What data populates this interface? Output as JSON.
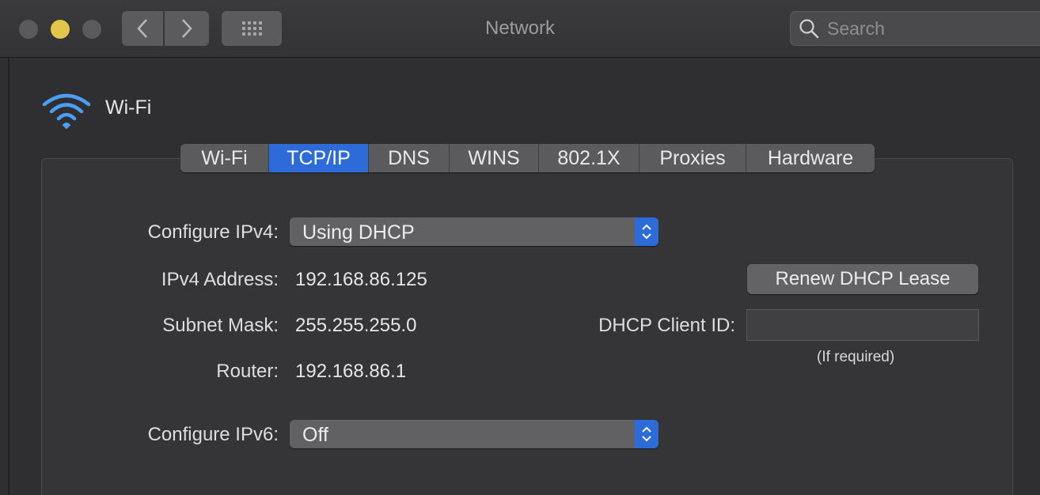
{
  "window": {
    "title": "Network"
  },
  "search": {
    "placeholder": "Search"
  },
  "interface": {
    "name": "Wi-Fi"
  },
  "tabs": [
    {
      "label": "Wi-Fi",
      "active": false
    },
    {
      "label": "TCP/IP",
      "active": true
    },
    {
      "label": "DNS",
      "active": false
    },
    {
      "label": "WINS",
      "active": false
    },
    {
      "label": "802.1X",
      "active": false
    },
    {
      "label": "Proxies",
      "active": false
    },
    {
      "label": "Hardware",
      "active": false
    }
  ],
  "tcpip": {
    "configure_ipv4_label": "Configure IPv4:",
    "configure_ipv4_value": "Using DHCP",
    "ipv4_address_label": "IPv4 Address:",
    "ipv4_address_value": "192.168.86.125",
    "subnet_mask_label": "Subnet Mask:",
    "subnet_mask_value": "255.255.255.0",
    "router_label": "Router:",
    "router_value": "192.168.86.1",
    "configure_ipv6_label": "Configure IPv6:",
    "configure_ipv6_value": "Off",
    "renew_button_label": "Renew DHCP Lease",
    "dhcp_client_id_label": "DHCP Client ID:",
    "dhcp_client_id_value": "",
    "dhcp_client_id_hint": "(If required)"
  },
  "colors": {
    "accent": "#2c6bd8",
    "minimize": "#e2c54b",
    "wifi_icon": "#4a9ff5"
  }
}
